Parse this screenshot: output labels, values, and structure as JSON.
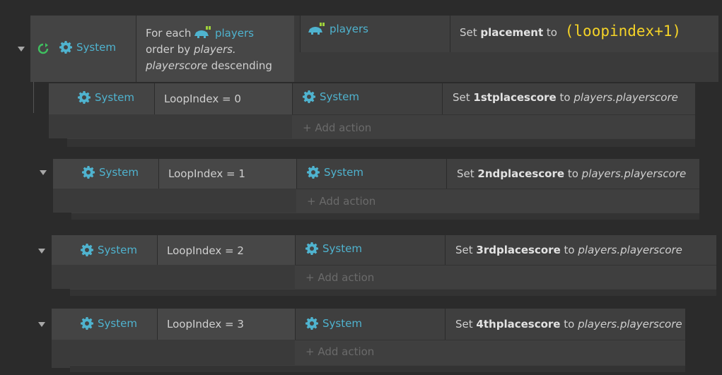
{
  "foreach_event": {
    "object": "System",
    "condition_prefix": "For each",
    "condition_object": "players",
    "condition_order_prefix": "order by",
    "condition_order_obj": "players.",
    "condition_order_field": "playerscore",
    "condition_order_dir": "descending",
    "action_object": "players",
    "action_prefix": "Set",
    "action_var": "placement",
    "action_to": "to",
    "action_value": "(loopindex+1)"
  },
  "sub_events": [
    {
      "object": "System",
      "condition": "LoopIndex = 0",
      "action_object": "System",
      "action_prefix": "Set",
      "action_var": "1stplacescore",
      "action_to": "to",
      "action_value": "players.playerscore"
    },
    {
      "object": "System",
      "condition": "LoopIndex = 1",
      "action_object": "System",
      "action_prefix": "Set",
      "action_var": "2ndplacescore",
      "action_to": "to",
      "action_value": "players.playerscore"
    },
    {
      "object": "System",
      "condition": "LoopIndex = 2",
      "action_object": "System",
      "action_prefix": "Set",
      "action_var": "3rdplacescore",
      "action_to": "to",
      "action_value": "players.playerscore"
    },
    {
      "object": "System",
      "condition": "LoopIndex = 3",
      "action_object": "System",
      "action_prefix": "Set",
      "action_var": "4thplacescore",
      "action_to": "to",
      "action_value": "players.playerscore"
    }
  ],
  "add_action_label": "+ Add action",
  "colors": {
    "accent": "#4fb3cf",
    "expression": "#f5d327",
    "loop_icon": "#3fbf5f"
  },
  "icons": [
    "loop-icon",
    "gear-icon",
    "sprite-icon",
    "collapse-triangle-icon"
  ]
}
